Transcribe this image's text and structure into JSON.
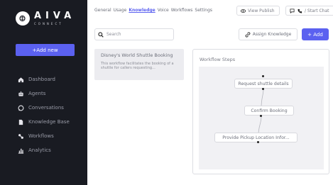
{
  "brand": {
    "name": "AIVA",
    "tagline": "CONNECT"
  },
  "sidebar": {
    "add_new_label": "+Add new",
    "items": [
      {
        "label": "Dashboard",
        "icon": "home-icon"
      },
      {
        "label": "Agents",
        "icon": "agent-icon"
      },
      {
        "label": "Conversations",
        "icon": "chat-icon"
      },
      {
        "label": "Knowledge Base",
        "icon": "document-icon"
      },
      {
        "label": "Workflows",
        "icon": "workflow-icon"
      },
      {
        "label": "Analytics",
        "icon": "chart-icon"
      }
    ]
  },
  "tabs": [
    {
      "label": "General",
      "active": false
    },
    {
      "label": "Usage",
      "active": false
    },
    {
      "label": "Knowledge",
      "active": true
    },
    {
      "label": "Voice",
      "active": false
    },
    {
      "label": "Workflows",
      "active": false
    },
    {
      "label": "Settings",
      "active": false
    }
  ],
  "toolbar": {
    "view_publish": "View Publish",
    "start_chat": "/ Start Chat"
  },
  "search": {
    "placeholder": "Search"
  },
  "actions": {
    "assign_knowledge": "Assign Knowledge",
    "add": "+ Add"
  },
  "knowledge_card": {
    "title": "Disney's World Shuttle Booking",
    "description": "This workflow facilitates the booking of a shuttle for callers requesting..."
  },
  "workflow": {
    "title": "Workflow Steps",
    "steps": [
      "Request shuttle details",
      "Confirm Booking",
      "Provide Pickup Location Infor..."
    ]
  },
  "colors": {
    "accent": "#5b61f0",
    "sidebar_bg": "#191b22"
  }
}
